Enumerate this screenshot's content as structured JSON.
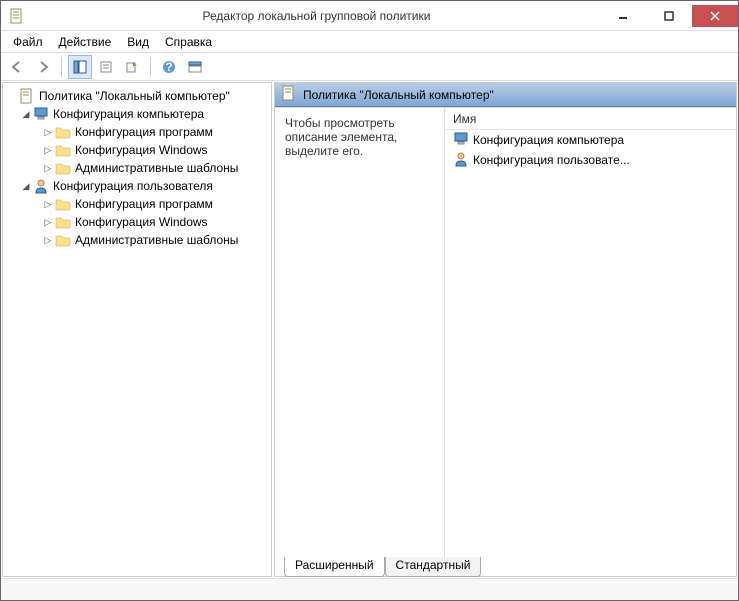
{
  "window": {
    "title": "Редактор локальной групповой политики"
  },
  "menu": {
    "file": "Файл",
    "action": "Действие",
    "view": "Вид",
    "help": "Справка"
  },
  "tree": {
    "root": "Политика \"Локальный компьютер\"",
    "comp": "Конфигурация компьютера",
    "comp_soft": "Конфигурация программ",
    "comp_win": "Конфигурация Windows",
    "comp_adm": "Административные шаблоны",
    "user": "Конфигурация пользователя",
    "user_soft": "Конфигурация программ",
    "user_win": "Конфигурация Windows",
    "user_adm": "Административные шаблоны"
  },
  "details": {
    "header": "Политика \"Локальный компьютер\"",
    "description": "Чтобы просмотреть описание элемента, выделите его.",
    "column_name": "Имя",
    "rows": {
      "r0": "Конфигурация компьютера",
      "r1": "Конфигурация пользовате..."
    }
  },
  "tabs": {
    "extended": "Расширенный",
    "standard": "Стандартный"
  }
}
